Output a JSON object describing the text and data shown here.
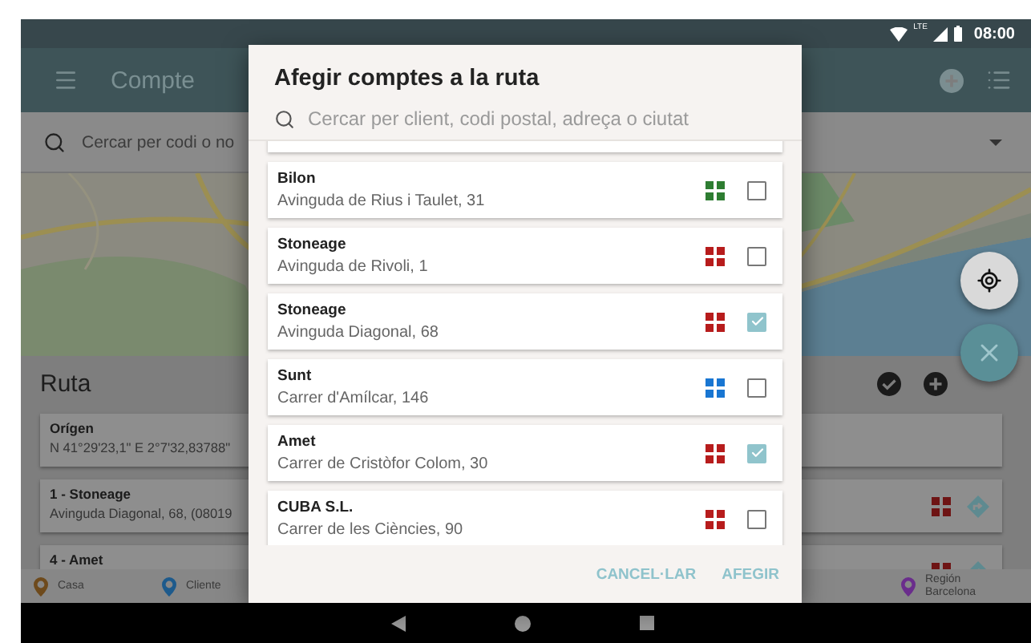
{
  "status_bar": {
    "network": "LTE",
    "time": "08:00"
  },
  "toolbar": {
    "title": "Compte"
  },
  "search": {
    "placeholder": "Cercar per codi o no"
  },
  "route": {
    "title": "Ruta",
    "stops": [
      {
        "kind": "origin",
        "title": "Orígen",
        "subtitle": "N 41°29'23,1\" E 2°7'32,83788\""
      },
      {
        "kind": "stop",
        "title": "1 - Stoneage",
        "subtitle": "Avinguda Diagonal, 68, (08019"
      },
      {
        "kind": "stop",
        "title": "4 - Amet"
      }
    ]
  },
  "legend": [
    {
      "label": "Casa",
      "color": "#6e4a1c"
    },
    {
      "label": "Cliente",
      "color": "#1d5a8c"
    },
    {
      "label": "Región Barcelona",
      "color": "#6a2d8c"
    }
  ],
  "dialog": {
    "title": "Afegir comptes a la ruta",
    "search_placeholder": "Cercar per client, codi postal, adreça o ciutat",
    "accounts": [
      {
        "name": "Bilon",
        "address": "Avinguda de Rius i Taulet, 31",
        "color": "#2e7d32",
        "checked": false
      },
      {
        "name": "Stoneage",
        "address": "Avinguda de Rivoli, 1",
        "color": "#b71c1c",
        "checked": false
      },
      {
        "name": "Stoneage",
        "address": "Avinguda Diagonal, 68",
        "color": "#b71c1c",
        "checked": true
      },
      {
        "name": "Sunt",
        "address": "Carrer d'Amílcar, 146",
        "color": "#1976d2",
        "checked": false
      },
      {
        "name": "Amet",
        "address": "Carrer de Cristòfor Colom, 30",
        "color": "#b71c1c",
        "checked": true
      },
      {
        "name": "CUBA S.L.",
        "address": "Carrer de les Ciències, 90",
        "color": "#b71c1c",
        "checked": false
      }
    ],
    "buttons": [
      "CANCEL·LAR",
      "AFEGIR"
    ]
  }
}
